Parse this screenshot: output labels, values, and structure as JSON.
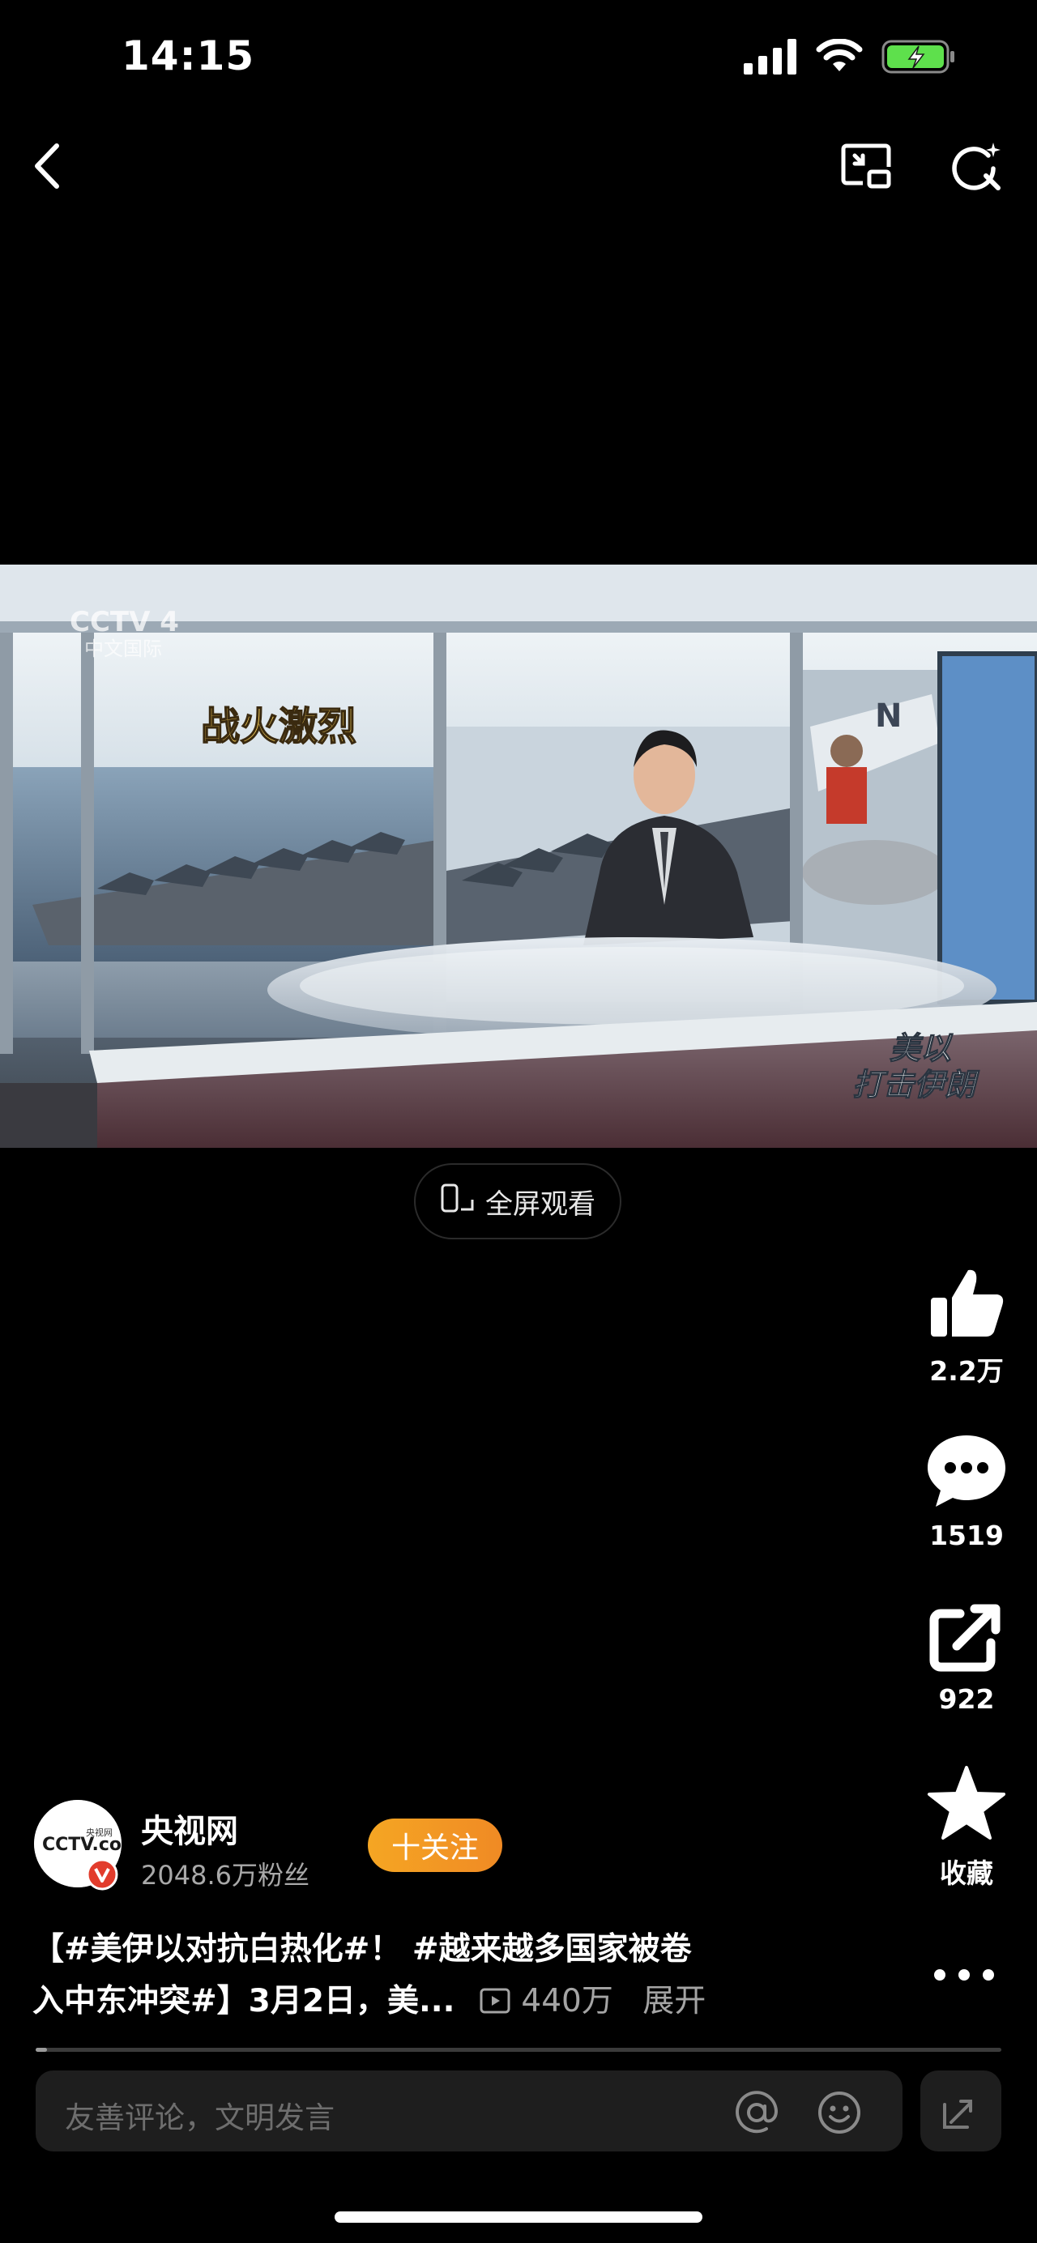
{
  "status_bar": {
    "time": "14:15",
    "icons": [
      "cellular-signal-icon",
      "wifi-icon",
      "battery-charging-icon"
    ]
  },
  "nav": {
    "icons": [
      "back-icon",
      "picture-in-picture-icon",
      "search-icon"
    ]
  },
  "video": {
    "channel_logo_lines": [
      "CCTV 4",
      "中文国际"
    ],
    "left_screen_banner": "战火激烈",
    "lower_right_overlay_lines": [
      "美以",
      "打击伊朗"
    ]
  },
  "fullscreen_button": {
    "label": "全屏观看"
  },
  "actions": {
    "like_count": "2.2万",
    "comment_count": "1519",
    "share_count": "922",
    "favorite_label": "收藏"
  },
  "author": {
    "name": "央视网",
    "fans": "2048.6万粉丝",
    "follow_label": "十关注",
    "avatar_text": "CCTV.com",
    "avatar_small_text": "央视网"
  },
  "caption": {
    "line1": "【#美伊以对抗白热化#！ #越来越多国家被卷",
    "line2": "入中东冲突#】3月2日，美...",
    "views": "440万",
    "expand_label": "展开"
  },
  "progress": {
    "fraction": 0.012
  },
  "comment": {
    "placeholder": "友善评论，文明发言"
  },
  "colors": {
    "background": "#000000",
    "follow_button": "#f29b25",
    "secondary_text": "#a4a4a4"
  }
}
